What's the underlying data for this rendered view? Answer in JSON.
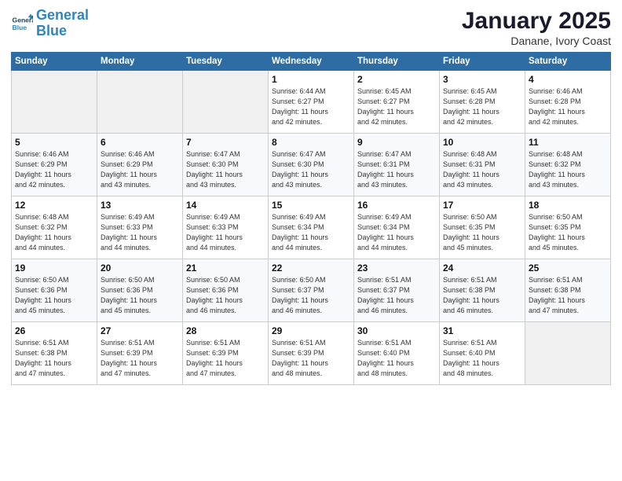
{
  "logo": {
    "line1": "General",
    "line2": "Blue"
  },
  "title": "January 2025",
  "subtitle": "Danane, Ivory Coast",
  "header": {
    "days": [
      "Sunday",
      "Monday",
      "Tuesday",
      "Wednesday",
      "Thursday",
      "Friday",
      "Saturday"
    ]
  },
  "weeks": [
    [
      {
        "day": "",
        "info": ""
      },
      {
        "day": "",
        "info": ""
      },
      {
        "day": "",
        "info": ""
      },
      {
        "day": "1",
        "info": "Sunrise: 6:44 AM\nSunset: 6:27 PM\nDaylight: 11 hours\nand 42 minutes."
      },
      {
        "day": "2",
        "info": "Sunrise: 6:45 AM\nSunset: 6:27 PM\nDaylight: 11 hours\nand 42 minutes."
      },
      {
        "day": "3",
        "info": "Sunrise: 6:45 AM\nSunset: 6:28 PM\nDaylight: 11 hours\nand 42 minutes."
      },
      {
        "day": "4",
        "info": "Sunrise: 6:46 AM\nSunset: 6:28 PM\nDaylight: 11 hours\nand 42 minutes."
      }
    ],
    [
      {
        "day": "5",
        "info": "Sunrise: 6:46 AM\nSunset: 6:29 PM\nDaylight: 11 hours\nand 42 minutes."
      },
      {
        "day": "6",
        "info": "Sunrise: 6:46 AM\nSunset: 6:29 PM\nDaylight: 11 hours\nand 43 minutes."
      },
      {
        "day": "7",
        "info": "Sunrise: 6:47 AM\nSunset: 6:30 PM\nDaylight: 11 hours\nand 43 minutes."
      },
      {
        "day": "8",
        "info": "Sunrise: 6:47 AM\nSunset: 6:30 PM\nDaylight: 11 hours\nand 43 minutes."
      },
      {
        "day": "9",
        "info": "Sunrise: 6:47 AM\nSunset: 6:31 PM\nDaylight: 11 hours\nand 43 minutes."
      },
      {
        "day": "10",
        "info": "Sunrise: 6:48 AM\nSunset: 6:31 PM\nDaylight: 11 hours\nand 43 minutes."
      },
      {
        "day": "11",
        "info": "Sunrise: 6:48 AM\nSunset: 6:32 PM\nDaylight: 11 hours\nand 43 minutes."
      }
    ],
    [
      {
        "day": "12",
        "info": "Sunrise: 6:48 AM\nSunset: 6:32 PM\nDaylight: 11 hours\nand 44 minutes."
      },
      {
        "day": "13",
        "info": "Sunrise: 6:49 AM\nSunset: 6:33 PM\nDaylight: 11 hours\nand 44 minutes."
      },
      {
        "day": "14",
        "info": "Sunrise: 6:49 AM\nSunset: 6:33 PM\nDaylight: 11 hours\nand 44 minutes."
      },
      {
        "day": "15",
        "info": "Sunrise: 6:49 AM\nSunset: 6:34 PM\nDaylight: 11 hours\nand 44 minutes."
      },
      {
        "day": "16",
        "info": "Sunrise: 6:49 AM\nSunset: 6:34 PM\nDaylight: 11 hours\nand 44 minutes."
      },
      {
        "day": "17",
        "info": "Sunrise: 6:50 AM\nSunset: 6:35 PM\nDaylight: 11 hours\nand 45 minutes."
      },
      {
        "day": "18",
        "info": "Sunrise: 6:50 AM\nSunset: 6:35 PM\nDaylight: 11 hours\nand 45 minutes."
      }
    ],
    [
      {
        "day": "19",
        "info": "Sunrise: 6:50 AM\nSunset: 6:36 PM\nDaylight: 11 hours\nand 45 minutes."
      },
      {
        "day": "20",
        "info": "Sunrise: 6:50 AM\nSunset: 6:36 PM\nDaylight: 11 hours\nand 45 minutes."
      },
      {
        "day": "21",
        "info": "Sunrise: 6:50 AM\nSunset: 6:36 PM\nDaylight: 11 hours\nand 46 minutes."
      },
      {
        "day": "22",
        "info": "Sunrise: 6:50 AM\nSunset: 6:37 PM\nDaylight: 11 hours\nand 46 minutes."
      },
      {
        "day": "23",
        "info": "Sunrise: 6:51 AM\nSunset: 6:37 PM\nDaylight: 11 hours\nand 46 minutes."
      },
      {
        "day": "24",
        "info": "Sunrise: 6:51 AM\nSunset: 6:38 PM\nDaylight: 11 hours\nand 46 minutes."
      },
      {
        "day": "25",
        "info": "Sunrise: 6:51 AM\nSunset: 6:38 PM\nDaylight: 11 hours\nand 47 minutes."
      }
    ],
    [
      {
        "day": "26",
        "info": "Sunrise: 6:51 AM\nSunset: 6:38 PM\nDaylight: 11 hours\nand 47 minutes."
      },
      {
        "day": "27",
        "info": "Sunrise: 6:51 AM\nSunset: 6:39 PM\nDaylight: 11 hours\nand 47 minutes."
      },
      {
        "day": "28",
        "info": "Sunrise: 6:51 AM\nSunset: 6:39 PM\nDaylight: 11 hours\nand 47 minutes."
      },
      {
        "day": "29",
        "info": "Sunrise: 6:51 AM\nSunset: 6:39 PM\nDaylight: 11 hours\nand 48 minutes."
      },
      {
        "day": "30",
        "info": "Sunrise: 6:51 AM\nSunset: 6:40 PM\nDaylight: 11 hours\nand 48 minutes."
      },
      {
        "day": "31",
        "info": "Sunrise: 6:51 AM\nSunset: 6:40 PM\nDaylight: 11 hours\nand 48 minutes."
      },
      {
        "day": "",
        "info": ""
      }
    ]
  ]
}
